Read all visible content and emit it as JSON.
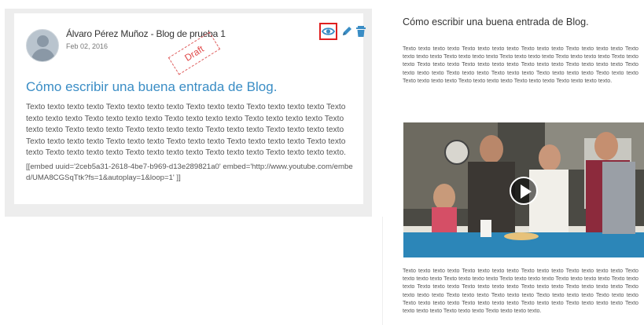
{
  "editor": {
    "post": {
      "author": "Álvaro Pérez Muñoz - Blog de prueba 1",
      "date": "Feb 02, 2016",
      "status_stamp": "Draft",
      "title": "Cómo escribir una buena entrada de Blog.",
      "body": " Texto texto texto texto  Texto texto texto texto Texto texto texto Texto texto texto texto Texto texto texto texto Texto texto texto texto Texto texto texto texto Texto texto texto texto Texto texto texto Texto texto texto Texto texto texto texto Texto texto texto Texto texto texto texto Texto texto texto texto Texto texto texto Texto texto texto Texto texto texto texto Texto texto texto Texto texto texto texto Texto texto texto texto Texto texto texto Texto texto texto texto.",
      "embed": " [[embed uuid='2ceb5a31-2618-4be7-b969-d13e289821a0' embed='http://www.youtube.com/embed/UMA8CGSqTtk?fs=1&autoplay=1&loop=1' ]]"
    },
    "actions": {
      "view_icon": "eye-icon",
      "edit_icon": "pencil-icon",
      "delete_icon": "trash-icon"
    }
  },
  "preview": {
    "title": "Cómo escribir una buena entrada de Blog.",
    "text_top": " Texto texto texto texto  Texto texto texto texto Texto texto texto Texto texto texto texto Texto texto texto texto Texto texto texto texto Texto texto texto texto Texto texto texto texto Texto texto texto Texto texto texto Texto texto texto texto Texto texto texto Texto texto texto texto Texto texto texto texto Texto texto texto Texto texto texto Texto texto texto texto Texto texto texto Texto texto texto texto Texto texto texto texto Texto texto texto Texto texto texto texto.",
    "text_bottom": " Texto texto texto texto Texto texto texto texto Texto texto texto Texto texto texto texto Texto texto texto texto Texto texto texto texto Texto texto texto texto Texto texto texto texto Texto texto texto Texto texto texto Texto texto texto texto Texto texto texto Texto texto texto texto Texto texto texto texto Texto texto texto Texto texto texto Texto texto texto texto Texto texto texto Texto texto texto texto Texto texto texto texto Texto texto texto Texto texto texto texto Texto texto texto texto Texto texto texto Texto texto texto texto.",
    "video": {
      "play_icon": "play-icon"
    }
  },
  "colors": {
    "accent_blue": "#3a8dc5",
    "highlight_red": "#e02020",
    "draft_red": "#e04a4a"
  }
}
